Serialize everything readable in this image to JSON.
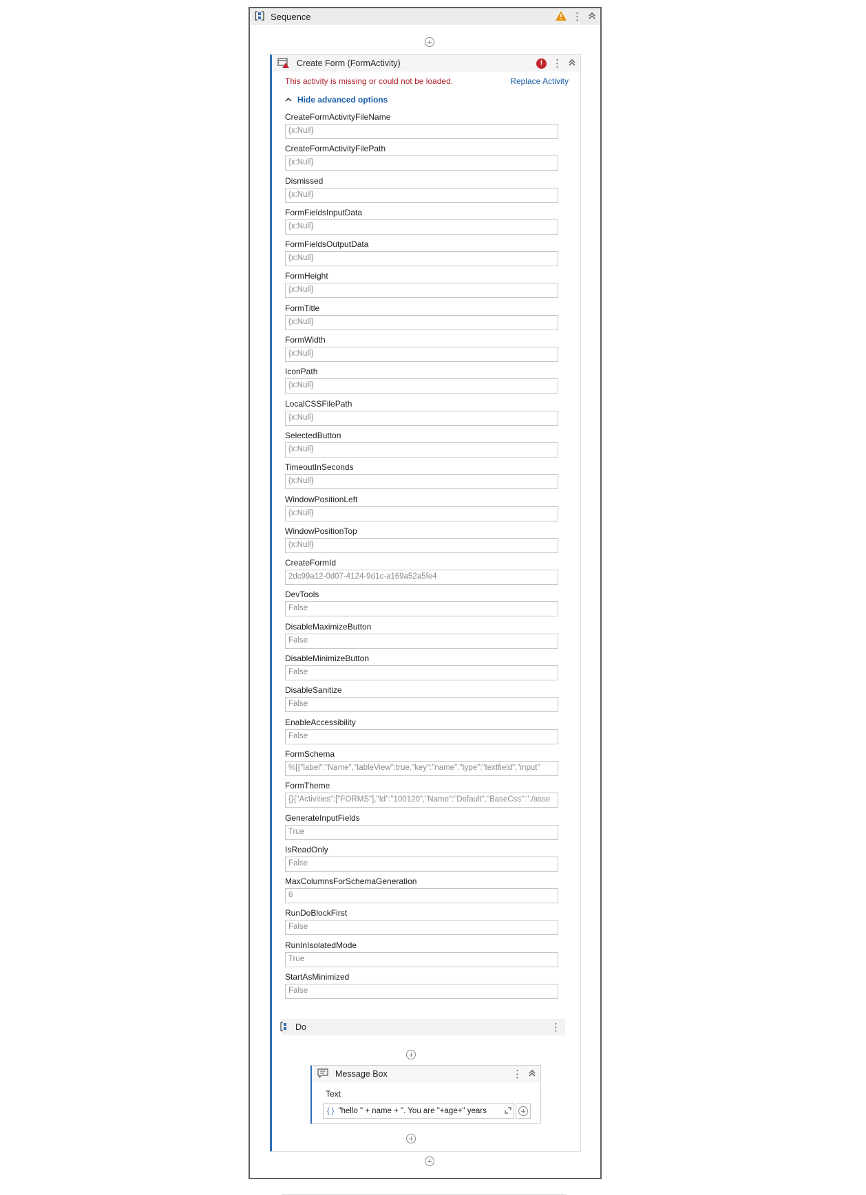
{
  "sequence": {
    "title": "Sequence"
  },
  "create_form": {
    "title": "Create Form (FormActivity)",
    "error_message": "This activity is missing or could not be loaded.",
    "replace_label": "Replace Activity",
    "advanced_toggle": "Hide advanced options",
    "fields": [
      {
        "label": "CreateFormActivityFileName",
        "value": "{x:Null}"
      },
      {
        "label": "CreateFormActivityFilePath",
        "value": "{x:Null}"
      },
      {
        "label": "Dismissed",
        "value": "{x:Null}"
      },
      {
        "label": "FormFieldsInputData",
        "value": "{x:Null}"
      },
      {
        "label": "FormFieldsOutputData",
        "value": "{x:Null}"
      },
      {
        "label": "FormHeight",
        "value": "{x:Null}"
      },
      {
        "label": "FormTitle",
        "value": "{x:Null}"
      },
      {
        "label": "FormWidth",
        "value": "{x:Null}"
      },
      {
        "label": "IconPath",
        "value": "{x:Null}"
      },
      {
        "label": "LocalCSSFilePath",
        "value": "{x:Null}"
      },
      {
        "label": "SelectedButton",
        "value": "{x:Null}"
      },
      {
        "label": "TimeoutInSeconds",
        "value": "{x:Null}"
      },
      {
        "label": "WindowPositionLeft",
        "value": "{x:Null}"
      },
      {
        "label": "WindowPositionTop",
        "value": "{x:Null}"
      },
      {
        "label": "CreateFormId",
        "value": "2dc99a12-0d07-4124-9d1c-a169a52a5fe4"
      },
      {
        "label": "DevTools",
        "value": "False"
      },
      {
        "label": "DisableMaximizeButton",
        "value": "False"
      },
      {
        "label": "DisableMinimizeButton",
        "value": "False"
      },
      {
        "label": "DisableSanitize",
        "value": "False"
      },
      {
        "label": "EnableAccessibility",
        "value": "False"
      },
      {
        "label": "FormSchema",
        "value": "%[{\"label\":\"Name\",\"tableView\":true,\"key\":\"name\",\"type\":\"textfield\",\"input\""
      },
      {
        "label": "FormTheme",
        "value": "{}{\"Activities\":[\"FORMS\"],\"Id\":\"100120\",\"Name\":\"Default\",\"BaseCss\":\"./asse"
      },
      {
        "label": "GenerateInputFields",
        "value": "True"
      },
      {
        "label": "IsReadOnly",
        "value": "False"
      },
      {
        "label": "MaxColumnsForSchemaGeneration",
        "value": "6"
      },
      {
        "label": "RunDoBlockFirst",
        "value": "False"
      },
      {
        "label": "RunInIsolatedMode",
        "value": "True"
      },
      {
        "label": "StartAsMinimized",
        "value": "False"
      }
    ]
  },
  "do_block": {
    "title": "Do"
  },
  "message_box": {
    "title": "Message Box",
    "text_label": "Text",
    "text_value": "\"hello \" + name + \". You are \"+age+\" years"
  },
  "icons": {
    "sequence": "sequence-icon",
    "warning": "warning-icon",
    "error": "error-icon",
    "form": "form-activity-icon",
    "message": "message-box-icon",
    "add": "add-activity-icon"
  },
  "colors": {
    "accent": "#2f6db5",
    "error": "#c4262e",
    "warning": "#e8900c",
    "link": "#1a5fa8"
  }
}
